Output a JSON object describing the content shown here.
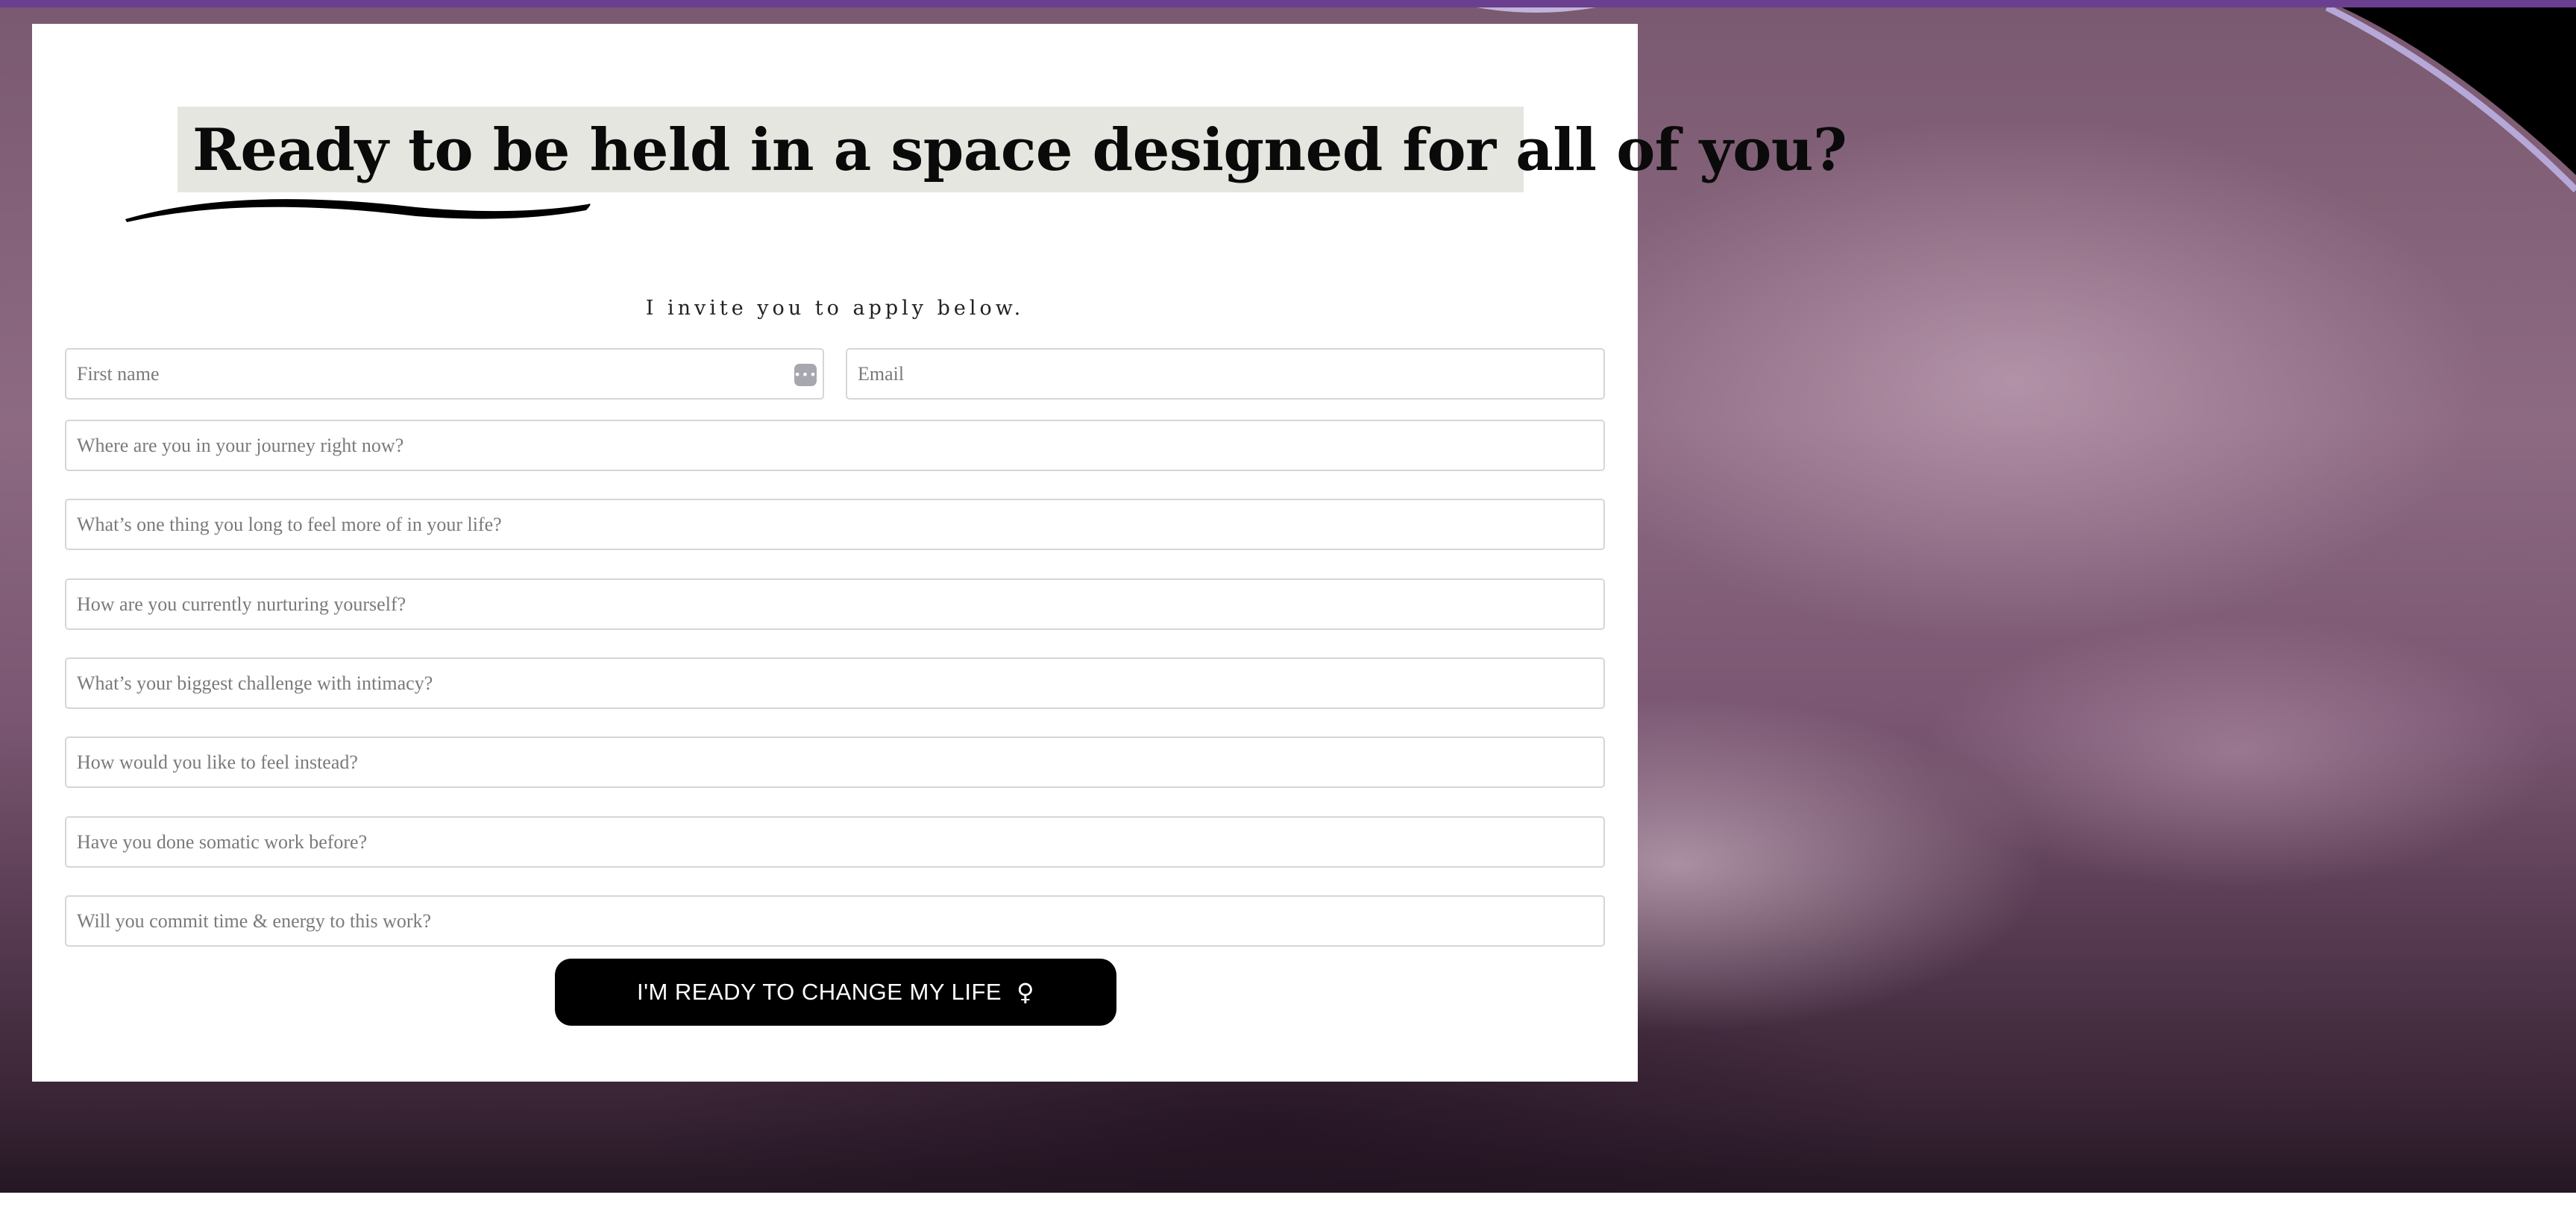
{
  "headline": "Ready to be held in a space designed for all of you?",
  "subheading": "I invite you to apply below.",
  "form": {
    "first_name_placeholder": "First name",
    "email_placeholder": "Email",
    "questions": [
      "Where are you in your journey right now?",
      "What’s one thing you long to feel more of in your life?",
      "How are you currently nurturing yourself?",
      "What’s your biggest challenge with intimacy?",
      "How would you like to feel instead?",
      "Have you done somatic work before?",
      "Will you commit time & energy to this work?"
    ],
    "password_manager_icon": "•••",
    "submit_label": "I'M READY TO CHANGE MY LIFE",
    "submit_icon": "♀",
    "submit_icon_name": "female-symbol-icon"
  },
  "colors": {
    "top_bar": "#6b3f8f",
    "button": "#000000",
    "headline_highlight": "#e6e6e0",
    "background_tone": "#8d6a82"
  }
}
